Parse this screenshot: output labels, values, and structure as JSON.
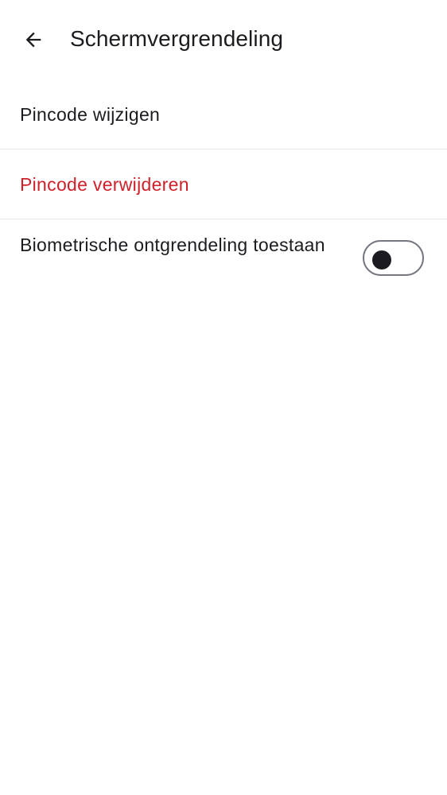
{
  "header": {
    "back_icon": "arrow-back-icon",
    "title": "Schermvergrendeling"
  },
  "settings": {
    "change_pin_label": "Pincode wijzigen",
    "remove_pin_label": "Pincode verwijderen",
    "remove_pin_color": "#d0202a",
    "biometric_label": "Biometrische ontgrendeling toestaan",
    "biometric_enabled": false
  }
}
